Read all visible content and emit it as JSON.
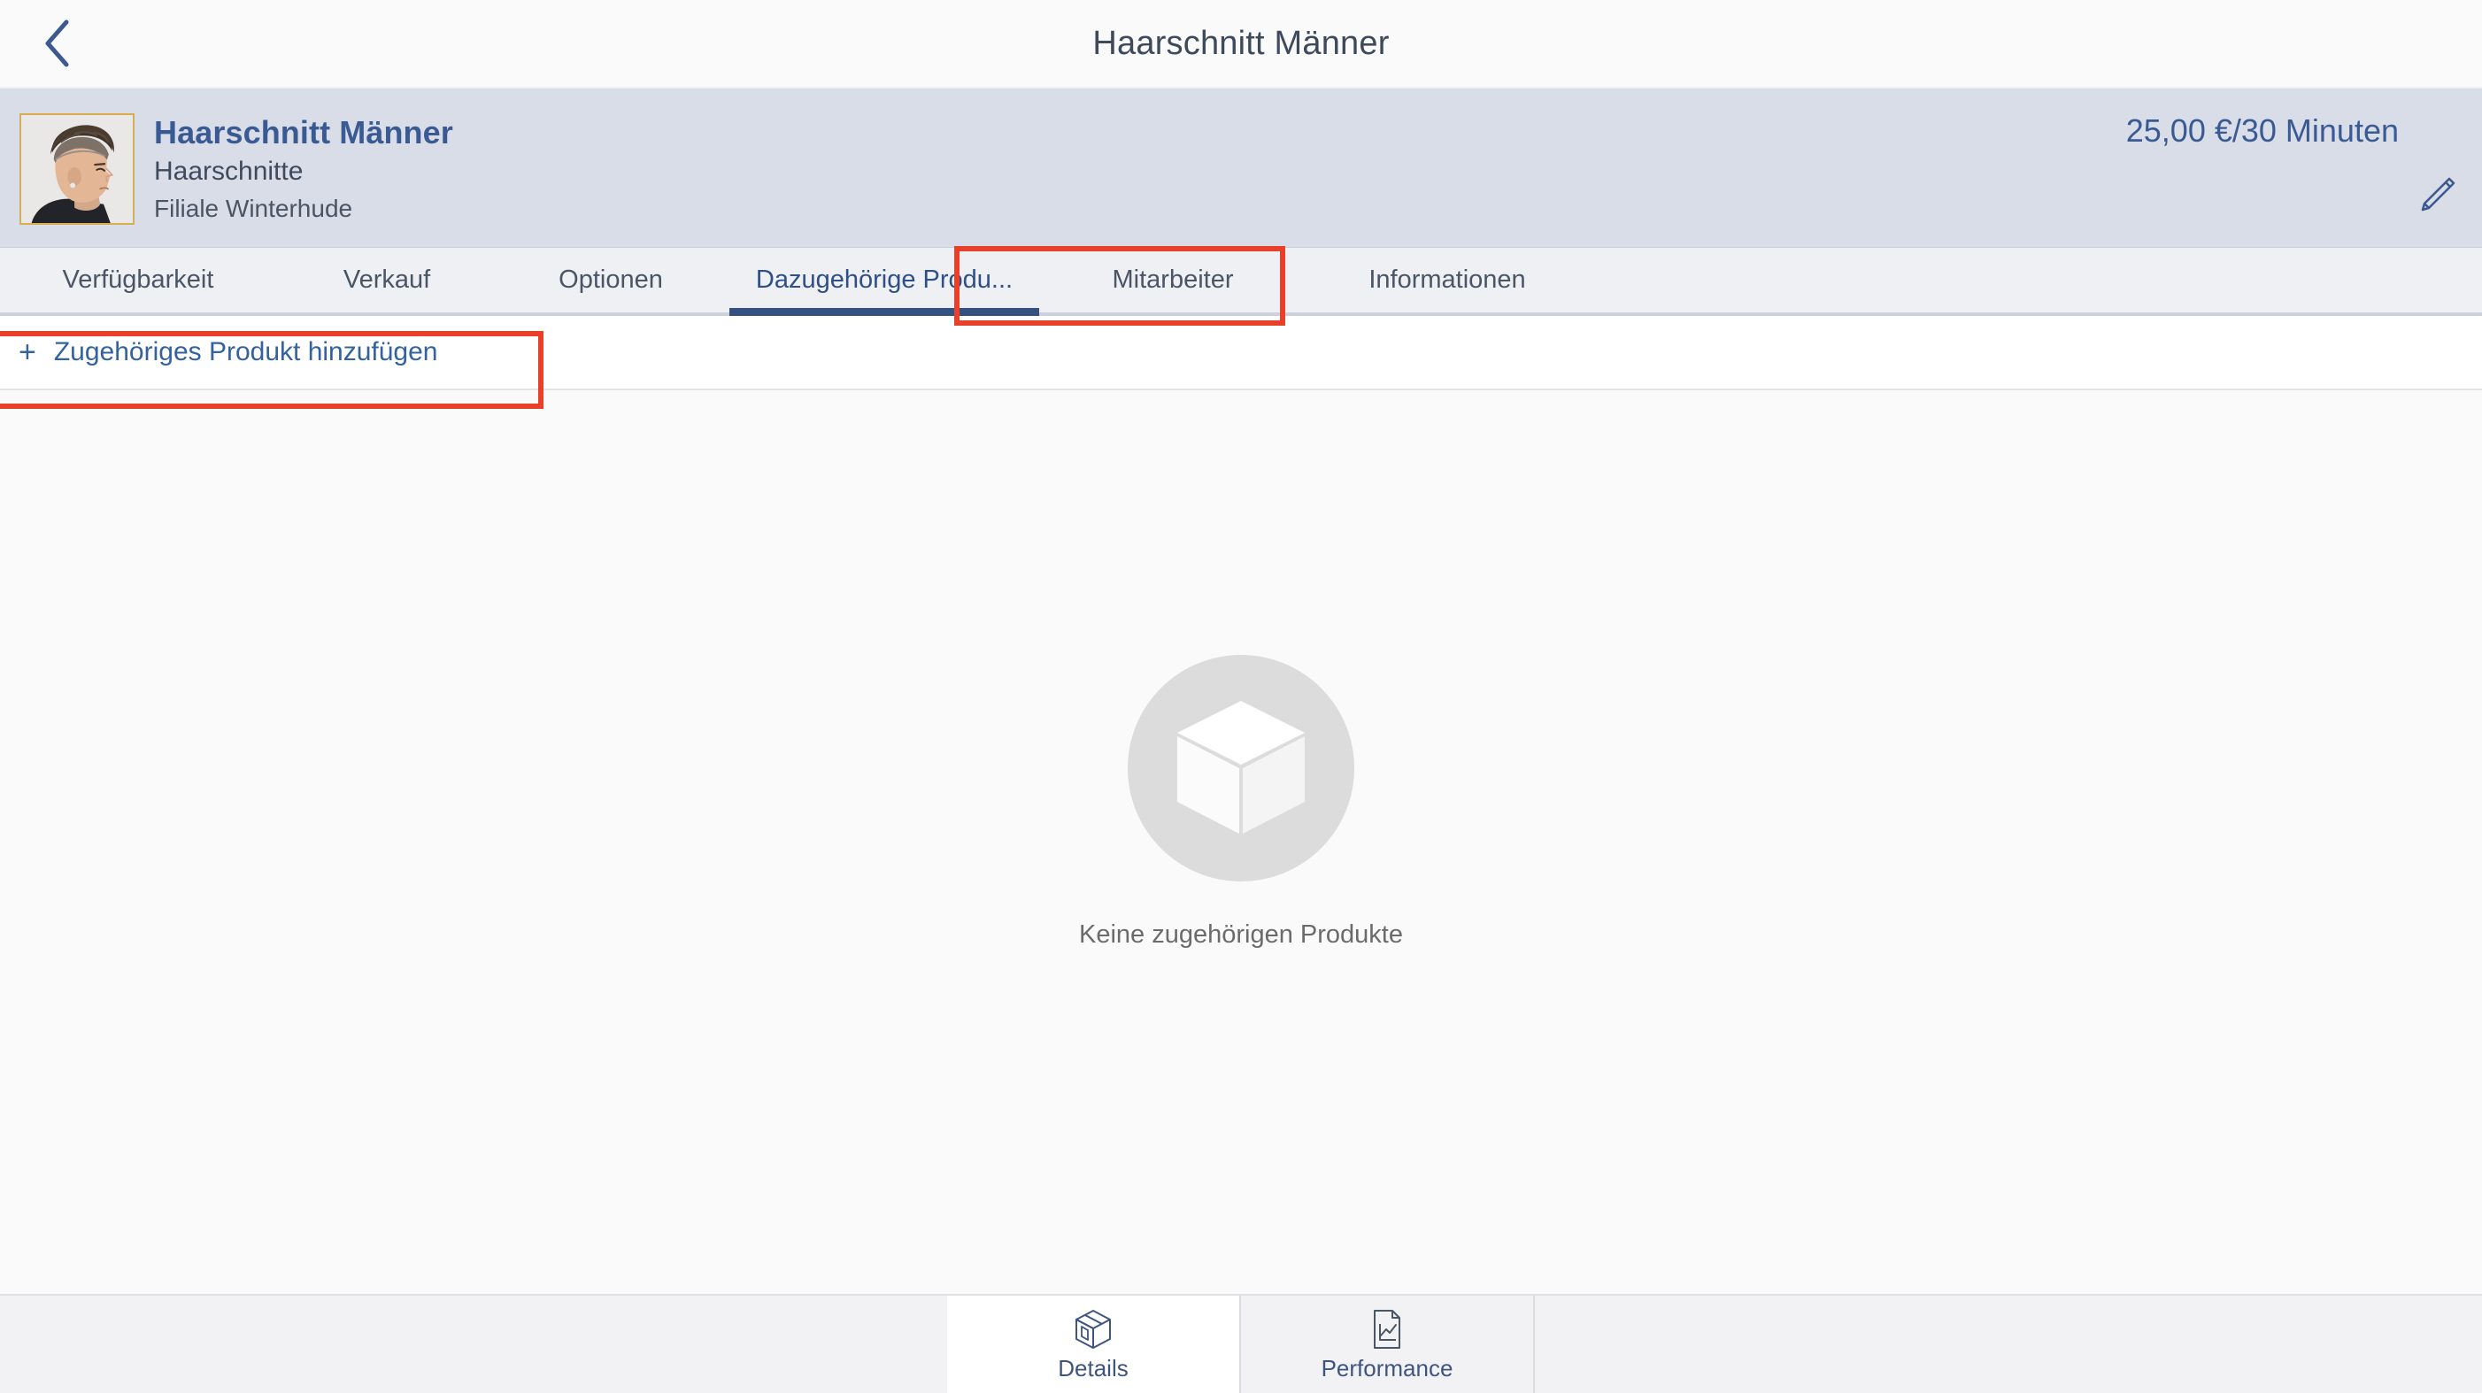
{
  "titlebar": {
    "back_icon": "chevron-left-icon",
    "title": "Haarschnitt Männer"
  },
  "service_header": {
    "avatar_alt": "mens-haircut-photo",
    "name": "Haarschnitt Männer",
    "category": "Haarschnitte",
    "branch": "Filiale Winterhude",
    "price": "25,00 €/30 Minuten",
    "edit_icon": "pencil-icon"
  },
  "tabs": [
    {
      "label": "Verfügbarkeit",
      "active": false
    },
    {
      "label": "Verkauf",
      "active": false
    },
    {
      "label": "Optionen",
      "active": false
    },
    {
      "label": "Dazugehörige Produ...",
      "active": true
    },
    {
      "label": "Mitarbeiter",
      "active": false
    },
    {
      "label": "Informationen",
      "active": false
    }
  ],
  "add_row": {
    "plus_icon": "plus-icon",
    "label": "Zugehöriges Produkt hinzufügen"
  },
  "empty_state": {
    "icon": "box-icon",
    "message": "Keine zugehörigen Produkte"
  },
  "bottom_nav": [
    {
      "label": "Details",
      "icon": "box-outline-icon",
      "active": true
    },
    {
      "label": "Performance",
      "icon": "document-chart-icon",
      "active": false
    }
  ],
  "colors": {
    "accent_blue": "#35517f",
    "link_blue": "#33629f",
    "header_band": "#d8dde8",
    "tabstrip_bg": "#eef0f4",
    "highlight_red": "#e8412a",
    "avatar_border": "#d8ae4e"
  }
}
